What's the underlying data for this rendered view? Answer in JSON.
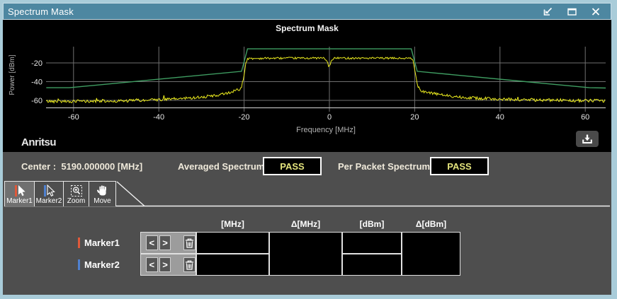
{
  "window": {
    "title": "Spectrum Mask",
    "controls": [
      {
        "icon": "pop-in-icon"
      },
      {
        "icon": "maximize-icon"
      },
      {
        "icon": "close-icon"
      }
    ]
  },
  "chart": {
    "title": "Spectrum Mask",
    "brand": "Anritsu",
    "download_icon": "download-icon",
    "chart_data": {
      "type": "line",
      "title": "Spectrum Mask",
      "xlabel": "Frequency [MHz]",
      "ylabel": "Power [dBm]",
      "xlim": [
        -66.4,
        64.8
      ],
      "ylim": [
        -67.5,
        -2.6
      ],
      "x_ticks": [
        -60,
        -40,
        -20,
        0,
        20,
        40,
        60
      ],
      "y_ticks": [
        -20,
        -40,
        -60
      ],
      "grid": true,
      "legend": false,
      "series": [
        {
          "name": "mask-limit",
          "color": "#3f9e62",
          "points": [
            [
              -66.4,
              -46.5
            ],
            [
              -61,
              -46.5
            ],
            [
              -20.6,
              -29
            ],
            [
              -19.2,
              -5
            ],
            [
              19.2,
              -5
            ],
            [
              20.6,
              -29
            ],
            [
              61,
              -46.5
            ],
            [
              64.8,
              -46.8
            ]
          ]
        },
        {
          "name": "measured-spectrum",
          "color": "#eded1f",
          "envelope_points": [
            [
              -66.4,
              -61
            ],
            [
              -52,
              -61
            ],
            [
              -44,
              -60
            ],
            [
              -38,
              -59
            ],
            [
              -33,
              -57.5
            ],
            [
              -29,
              -56
            ],
            [
              -26,
              -54.5
            ],
            [
              -24,
              -52.5
            ],
            [
              -22.6,
              -50.5
            ],
            [
              -21.8,
              -48
            ],
            [
              -21.2,
              -49.5
            ],
            [
              -20.6,
              -45
            ],
            [
              -20.1,
              -36
            ],
            [
              -19.6,
              -20
            ],
            [
              -19.2,
              -15.5
            ],
            [
              -15,
              -15
            ],
            [
              -1.3,
              -14.8
            ],
            [
              -0.6,
              -18
            ],
            [
              -0.1,
              -24.5
            ],
            [
              0.4,
              -18.5
            ],
            [
              1.2,
              -14.8
            ],
            [
              15,
              -15
            ],
            [
              19,
              -15.2
            ],
            [
              19.6,
              -17
            ],
            [
              20.1,
              -30
            ],
            [
              20.7,
              -44
            ],
            [
              21.4,
              -49
            ],
            [
              22.5,
              -51
            ],
            [
              24,
              -52.5
            ],
            [
              27,
              -54.5
            ],
            [
              31,
              -56.5
            ],
            [
              36,
              -58
            ],
            [
              43,
              -59
            ],
            [
              52,
              -59.8
            ],
            [
              64.8,
              -60.5
            ]
          ],
          "noise_db_floor": 1.6,
          "noise_db_top": 1.0
        }
      ]
    }
  },
  "status": {
    "center_label": "Center :  5190.000000 [MHz]",
    "averaged_label": "Averaged Spectrum",
    "averaged_value": "PASS",
    "per_packet_label": "Per Packet Spectrum",
    "per_packet_value": "PASS"
  },
  "tabs": [
    {
      "label": "Marker1",
      "icon": "marker1-cursor-icon",
      "selected": true
    },
    {
      "label": "Marker2",
      "icon": "marker2-cursor-icon",
      "selected": false
    },
    {
      "label": "Zoom",
      "icon": "zoom-magnifier-icon",
      "selected": false
    },
    {
      "label": "Move",
      "icon": "move-hand-icon",
      "selected": false
    }
  ],
  "table": {
    "headers": [
      "[MHz]",
      "Δ[MHz]",
      "[dBm]",
      "Δ[dBm]"
    ],
    "rows": [
      {
        "label": "Marker1",
        "color": "#e0593a",
        "mhz": "",
        "d_mhz": "",
        "dbm": "",
        "d_dbm": ""
      },
      {
        "label": "Marker2",
        "color": "#4f81d0",
        "mhz": "",
        "d_mhz": "",
        "dbm": "",
        "d_dbm": ""
      }
    ]
  },
  "colors": {
    "frame": "#a9ccd9",
    "titlebar": "#4d87a1",
    "panel": "#4e4e4e",
    "trace": "#eded1f",
    "mask": "#3f9e62",
    "pass_text": "#e3e37c",
    "marker1": "#e0593a",
    "marker2": "#4f81d0"
  }
}
